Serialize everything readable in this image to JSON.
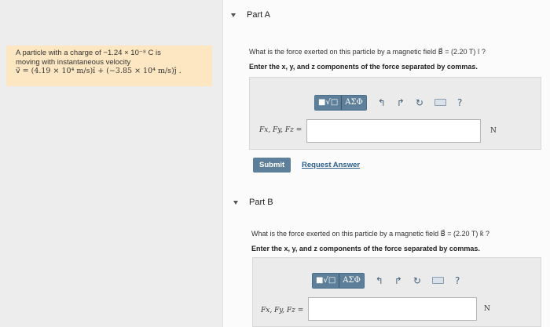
{
  "problem": {
    "line1": "A particle with a charge of −1.24 × 10⁻⁸ C is",
    "line2": "moving with instantaneous velocity",
    "line3": "v⃗ = (4.19 × 10⁴ m/s)î + (−3.85 × 10⁴ m/s)ĵ ."
  },
  "partA": {
    "title": "Part A",
    "question": "What is the force exerted on this particle by a magnetic field B⃗ = (2.20  T) î ?",
    "instruction": "Enter the x, y, and z components of the force separated by commas.",
    "field_label": "Fx, Fy, Fz =",
    "input_value": "",
    "unit": "N",
    "submit_label": "Submit",
    "request_answer_label": "Request Answer"
  },
  "partB": {
    "title": "Part B",
    "question": "What is the force exerted on this particle by a magnetic field B⃗ = (2.20  T) k̂ ?",
    "instruction": "Enter the x, y, and z components of the force separated by commas.",
    "field_label": "Fx, Fy, Fz =",
    "input_value": "",
    "unit": "N"
  },
  "toolbar": {
    "templates_label": "■√□",
    "symbols_label": "AΣΦ",
    "undo_icon": "↰",
    "redo_icon": "↱",
    "reset_icon": "↻",
    "help_icon": "?"
  }
}
